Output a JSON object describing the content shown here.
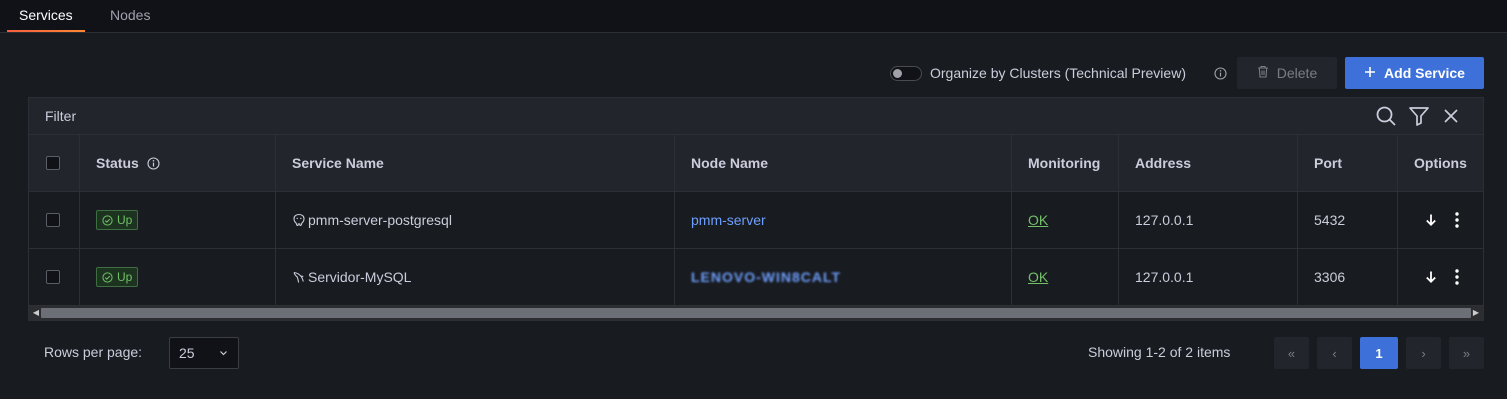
{
  "tabs": [
    {
      "label": "Services",
      "active": true
    },
    {
      "label": "Nodes",
      "active": false
    }
  ],
  "toolbar": {
    "organize_label": "Organize by Clusters (Technical Preview)",
    "organize_enabled": false,
    "delete_label": "Delete",
    "add_service_label": "Add Service"
  },
  "filter": {
    "label": "Filter"
  },
  "table": {
    "columns": [
      "Status",
      "Service Name",
      "Node Name",
      "Monitoring",
      "Address",
      "Port",
      "Options"
    ],
    "rows": [
      {
        "status": "Up",
        "service_icon": "postgresql-icon",
        "service_name": "pmm-server-postgresql",
        "node_name": "pmm-server",
        "node_redacted": false,
        "monitoring": "OK",
        "address": "127.0.0.1",
        "port": "5432"
      },
      {
        "status": "Up",
        "service_icon": "mysql-icon",
        "service_name": "Servidor-MySQL",
        "node_name": "LENOVO-WIN8CALT",
        "node_redacted": true,
        "monitoring": "OK",
        "address": "127.0.0.1",
        "port": "3306"
      }
    ]
  },
  "pagination": {
    "rows_per_page_label": "Rows per page:",
    "rows_per_page_value": "25",
    "showing_text": "Showing 1-2 of 2 items",
    "current_page": "1",
    "first": "«",
    "prev": "‹",
    "next": "›",
    "last": "»"
  },
  "colors": {
    "accent_primary": "#3d71d9",
    "status_ok": "#73bf69",
    "link": "#6e9fff",
    "tab_underline": "#f55f3e"
  }
}
